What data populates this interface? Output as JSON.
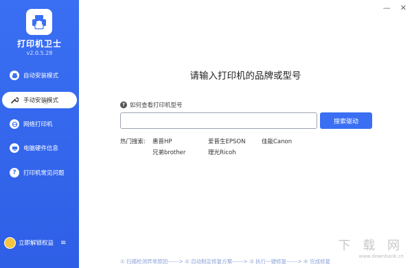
{
  "app": {
    "name": "打印机卫士",
    "version": "v2.0.5.28"
  },
  "sidebar": {
    "items": [
      {
        "label": "自动安装模式",
        "icon": "printer-icon",
        "active": false
      },
      {
        "label": "手动安装模式",
        "icon": "wrench-icon",
        "active": true
      },
      {
        "label": "网络打印机",
        "icon": "network-icon",
        "active": false
      },
      {
        "label": "电脑硬件信息",
        "icon": "hardware-icon",
        "active": false
      },
      {
        "label": "打印机常见问题",
        "icon": "question-icon",
        "active": false
      }
    ],
    "unlock_label": "立即解锁权益"
  },
  "window": {
    "minimize": "—",
    "close": "✕"
  },
  "main": {
    "title": "请输入打印机的品牌或型号",
    "help_text": "如何查看打印机型号",
    "search": {
      "value": "",
      "placeholder": "",
      "button_label": "搜索驱动"
    },
    "hot_label": "热门搜索:",
    "hot_items": [
      "惠普HP",
      "爱普生EPSON",
      "佳能Canon",
      "兄弟brother",
      "理光Ricoh"
    ]
  },
  "steps_text": "① 扫描检测异常原因------> ② 自动制定修复方案------> ③ 执行一键修复------> ④ 完成修复",
  "watermark": {
    "big": "下 载 网",
    "small": "www.downbank.cn"
  },
  "colors": {
    "sidebar": "#3a6ff3",
    "accent": "#3a6ff3"
  }
}
